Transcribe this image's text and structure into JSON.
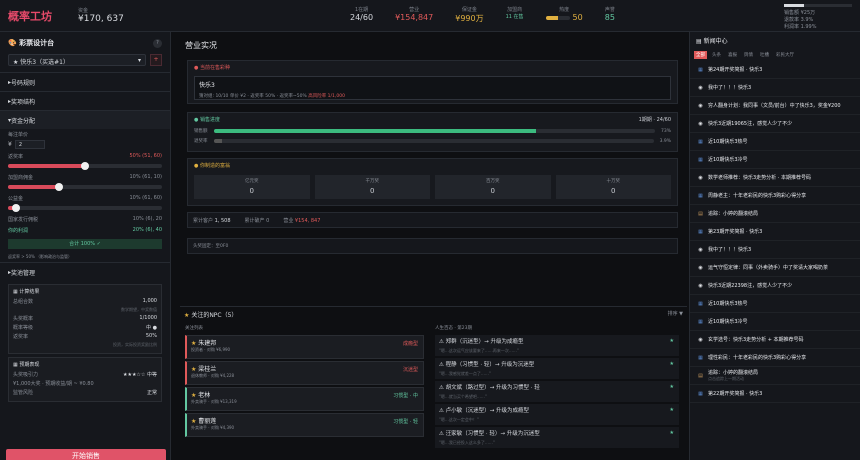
{
  "header": {
    "logo": "概率工坊",
    "fund_label": "资金",
    "fund_value": "¥170, 637"
  },
  "stats": [
    {
      "label": "1在期",
      "value": "24/60",
      "cls": ""
    },
    {
      "label": "营业",
      "value": "¥154,847",
      "cls": "red"
    },
    {
      "label": "保证金",
      "value": "¥990万",
      "cls": "gold"
    },
    {
      "label": "加盟商",
      "value": "11 在售",
      "cls": "mint small"
    },
    {
      "label": "热度",
      "value": "50",
      "cls": "gold"
    },
    {
      "label": "声誉",
      "value": "85",
      "cls": "mint"
    }
  ],
  "heat_level": 0.5,
  "top_right": {
    "line1": "销售额 ¥25万",
    "line2": "退款率 3.9%",
    "line3": "利润率 1.99%"
  },
  "left": {
    "title": "彩票设计台",
    "help": "?",
    "product_select": "★ 快乐3（买选#1）",
    "plus": "+",
    "sections": [
      "号码规则",
      "奖项结构",
      "资金分配"
    ],
    "price_label": "每注单价",
    "price_value": "2",
    "currency": "¥",
    "prize_rate_label": "返奖率",
    "prize_rate_value": "50% (51, 60)",
    "prize_rate_level": 0.5,
    "fund_rate_label": "加盟商佣金",
    "fund_rate_value": "10% (61, 10)",
    "fund_rate_level": 0.33,
    "public_label": "公益金",
    "public_value": "10% (61, 60)",
    "public_rate_level": 0.05,
    "dist_label": "国家发行佣税",
    "dist_value": "10% (6), 20",
    "profit_label": "你的利润",
    "profit_value": "20% (6), 40",
    "ok_text": "合计 100% ✓",
    "ok_note": "返奖率 > 50% （影响政治与监管）",
    "pool_section": "奖池管理",
    "calc": {
      "title": "计算结果",
      "rows": [
        {
          "k": "总组合数",
          "v": "1,000"
        },
        {
          "k": "",
          "v": "数学期望，中奖数值"
        },
        {
          "k": "头奖概率",
          "v": "1/1000"
        },
        {
          "k": "概率等级",
          "v": "中 ●"
        },
        {
          "k": "返奖率",
          "v": "50%"
        },
        {
          "k": "",
          "v": "投资，实际投资奖励比例"
        }
      ]
    },
    "pred": {
      "title": "预期表现",
      "rows": [
        {
          "k": "头奖吸引力",
          "v": "★★★☆☆ 中等"
        },
        {
          "k": "¥1,000大奖 · 预期收益/期 ~ ¥0.80",
          "v": ""
        },
        {
          "k": "监管风险",
          "v": "正常"
        }
      ]
    },
    "start": "开始销售"
  },
  "main": {
    "title": "营业实况",
    "on_sale_label": "当前在售彩种",
    "product_name": "快乐3",
    "product_meta": "猜对组: 10/10    单价 ¥2 · 返奖率 50% · 返奖率~50%",
    "product_warn": "高风险率 1/1,000",
    "progress_label": "销售进度",
    "progress_right": "1期期 · 24/60",
    "progress_rows": [
      {
        "k": "销售额",
        "v": "73%",
        "pct": 0.73
      },
      {
        "k": "退奖率",
        "v": "3.9%",
        "pct": 0.02
      }
    ],
    "awards_label": "你制造的富翁",
    "awards": [
      {
        "k": "亿元奖",
        "v": "0"
      },
      {
        "k": "千万奖",
        "v": "0"
      },
      {
        "k": "百万奖",
        "v": "0"
      },
      {
        "k": "十万奖",
        "v": "0"
      }
    ],
    "tot_players_label": "累计客户",
    "tot_players": "1, 508",
    "tot_agents_label": "累计破产",
    "tot_agents": "0",
    "tot_sales_label": "营业",
    "tot_sales": "¥154, 847",
    "fixed": "头奖固定：至0F0"
  },
  "npc": {
    "title": "关注的NPC（5）",
    "sort": "排序 ▼",
    "left_head": "关注列表",
    "right_head": "人生百态 · 第23期",
    "cards": [
      {
        "name": "朱建邦",
        "sub": "投资者 · 对购 ¥6,990",
        "tag": "成瘾型",
        "tagcls": "red"
      },
      {
        "name": "梁桂兰",
        "sub": "退休教师 · 对购 ¥4,228",
        "tag": "沉迷型",
        "tagcls": "red"
      },
      {
        "name": "老林",
        "sub": "外卖骑手 · 对购 ¥13,319",
        "tag": "习惯型 · 中",
        "tagcls": "green"
      },
      {
        "name": "曹丽莲",
        "sub": "外卖骑手 · 对购 ¥4,390",
        "tag": "习惯型 · 轻",
        "tagcls": "green"
      }
    ],
    "events": [
      {
        "t": "⚠ 郑群（沉迷型）→ 升级为成瘾型",
        "s": "\"嗯…这次运气应该要来了……再来一次……\""
      },
      {
        "t": "⚠ 程静（习惯型 · 轻）→ 升级为沉迷型",
        "s": "\"嗯…我感觉就差一点了……\""
      },
      {
        "t": "⚠ 胡文斌（路过型）→ 升级为习惯型 · 轻",
        "s": "\"嗯…就当买个希望吧……\""
      },
      {
        "t": "⚠ 卢小敏（沉迷型）→ 升级为成瘾型",
        "s": "\"嗯…这次一定会中！\""
      },
      {
        "t": "⚠ 汪家敏（习惯型 · 轻）→ 升级为沉迷型",
        "s": "\"嗯…我已经投入这么多了……\""
      }
    ]
  },
  "news": {
    "title": "新闻中心",
    "tabs": [
      "全部",
      "头条",
      "喜报",
      "舆情",
      "吐槽",
      "彩民大厅"
    ],
    "items": [
      {
        "t": "第24期开奖简报 · 快乐3",
        "i": "doc",
        "sub": ""
      },
      {
        "t": "我中了！！！快乐3",
        "i": "bubble",
        "sub": ""
      },
      {
        "t": "穷人翻身计划：我同事（文员/前台）中了快乐3，奖金¥200",
        "i": "bubble",
        "sub": ""
      },
      {
        "t": "快乐3近期19065注，感觉人少了不少",
        "i": "bubble",
        "sub": ""
      },
      {
        "t": "近10期快乐3热号",
        "i": "doc",
        "sub": ""
      },
      {
        "t": "近10期快乐3冷号",
        "i": "doc",
        "sub": ""
      },
      {
        "t": "数学老师推荐：快乐3走势分析 · 本期推荐号码",
        "i": "bubble",
        "sub": ""
      },
      {
        "t": "周静老主：十年老彩民的快乐3购彩心得分享",
        "i": "doc",
        "sub": ""
      },
      {
        "t": "追踪：小婷的翻滚结局",
        "i": "note",
        "sub": ""
      },
      {
        "t": "第23期开奖简报 · 快乐3",
        "i": "doc",
        "sub": ""
      },
      {
        "t": "我中了！！！快乐3",
        "i": "bubble",
        "sub": ""
      },
      {
        "t": "运气守恒定律：同事（外卖骑手）中了奖请大家喝奶茶",
        "i": "bubble",
        "sub": ""
      },
      {
        "t": "快乐3近期22398注，感觉人少了不少",
        "i": "bubble",
        "sub": ""
      },
      {
        "t": "近10期快乐3热号",
        "i": "doc",
        "sub": ""
      },
      {
        "t": "近10期快乐3冷号",
        "i": "doc",
        "sub": ""
      },
      {
        "t": "玄学选号：快乐3走势分析 + 本期推荐号码",
        "i": "bubble",
        "sub": ""
      },
      {
        "t": "理性彩民：十年老彩民的快乐3购彩心得分享",
        "i": "doc",
        "sub": ""
      },
      {
        "t": "追踪：小婷的翻滚结局",
        "i": "note",
        "sub": "点击追踪上一期活动"
      },
      {
        "t": "第22期开奖简报 · 快乐3",
        "i": "doc",
        "sub": ""
      }
    ]
  }
}
